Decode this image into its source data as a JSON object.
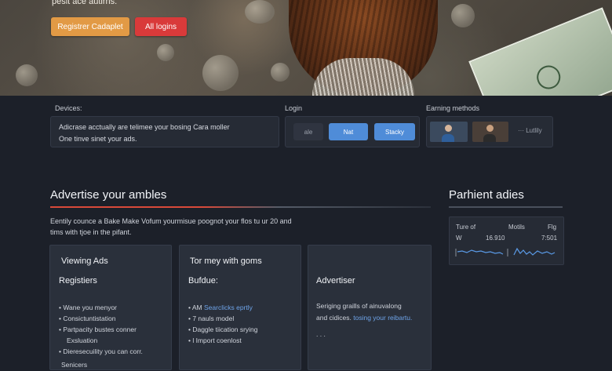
{
  "hero": {
    "caption": "peslt ace autirns.",
    "primary_button": "Registrer Cadaplet",
    "secondary_button": "All logins"
  },
  "devices": {
    "label": "Devices:",
    "line1": "Adicrase acctually are telimee your bosing Cara moller",
    "line2": "One tinve sinet your ads."
  },
  "login": {
    "label": "Login",
    "items": [
      "ale",
      "Nat",
      "Stacky"
    ]
  },
  "earning": {
    "label": "Earning methods",
    "more": "··· Lutlily"
  },
  "main": {
    "title": "Advertise your ambles",
    "intro": "Eentily counce a Bake Make Vofum yourmisue poognot your flos tu ur 20 and tims with tjoe in the pifant."
  },
  "cards": [
    {
      "title": "Viewing Ads",
      "subtitle": "Registiers",
      "items": [
        "Wane you menyor",
        "Consictuntistation",
        "Partpacity bustes conner",
        "Exsluation",
        "Dieresecuility you can corr."
      ],
      "footer": "Senicers"
    },
    {
      "title": "Tor mey with goms",
      "subtitle": "Bufdue:",
      "items": [
        {
          "prefix": "AM",
          "link": "Searclicks eprtly"
        },
        {
          "text": "7 nauls model"
        },
        {
          "text": "Daggle tiication srying"
        },
        {
          "text": "l Import coenlost"
        }
      ]
    },
    {
      "title": "Advertiser",
      "line1": "Seriging graills of ainuvalong",
      "line2_prefix": "and cidices.",
      "line2_link": "tosing your reibartu.",
      "more": ". . ."
    }
  ],
  "side": {
    "title": "Parhient adies",
    "headers": [
      "Ture of",
      "Motils",
      "Flg"
    ],
    "row": [
      "W",
      "16.910",
      "7:501"
    ]
  },
  "colors": {
    "accent_orange": "#e29a45",
    "accent_red": "#d93a3a",
    "accent_blue": "#4f8cd8",
    "sparkline": "#5a9ae6"
  }
}
